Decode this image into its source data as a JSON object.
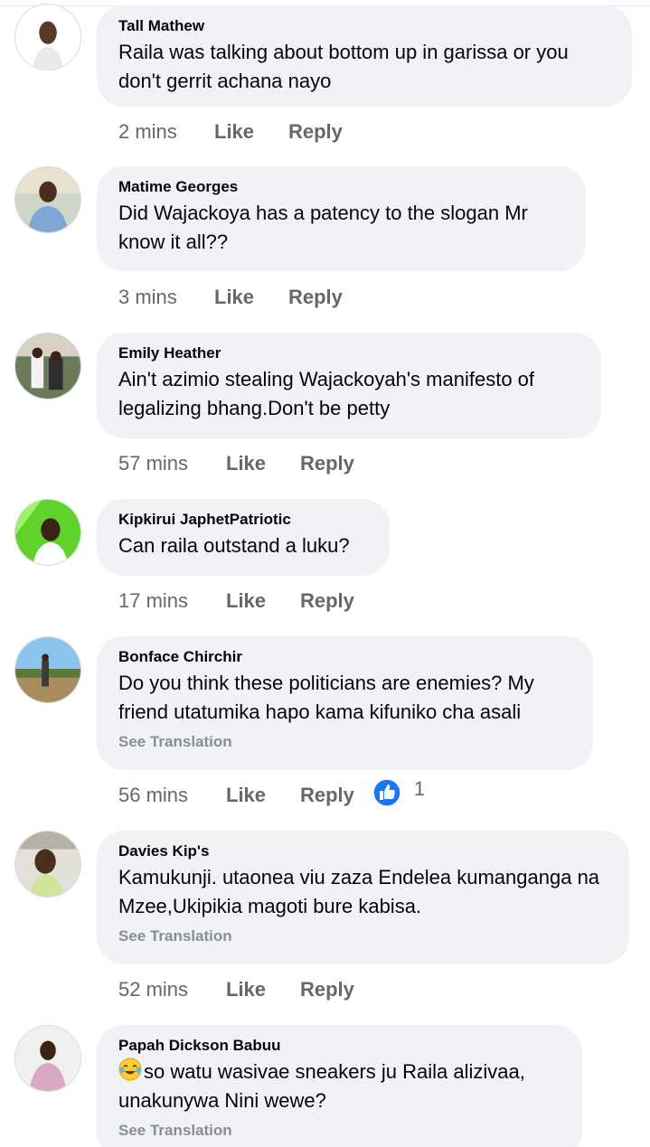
{
  "comments": [
    {
      "author": "Tall Mathew",
      "text": "Raila was talking about bottom up in garissa or you don't gerrit achana nayo",
      "time": "2 mins",
      "like_label": "Like",
      "reply_label": "Reply"
    },
    {
      "author": "Matime Georges",
      "text": "Did Wajackoya has a patency to the slogan Mr know it all??",
      "time": "3 mins",
      "like_label": "Like",
      "reply_label": "Reply"
    },
    {
      "author": "Emily Heather",
      "text": "Ain't azimio stealing Wajackoyah's manifesto of legalizing bhang.Don't be petty",
      "time": "57 mins",
      "like_label": "Like",
      "reply_label": "Reply"
    },
    {
      "author": "Kipkirui JaphetPatriotic",
      "text": "Can raila outstand a luku?",
      "time": "17 mins",
      "like_label": "Like",
      "reply_label": "Reply"
    },
    {
      "author": "Bonface Chirchir",
      "text": "Do you think these politicians are enemies? My friend utatumika hapo kama kifuniko cha asali",
      "see_translation": "See Translation",
      "time": "56 mins",
      "like_label": "Like",
      "reply_label": "Reply",
      "reaction_icon": "thumbs-up-icon",
      "reaction_count": "1"
    },
    {
      "author": "Davies Kip's",
      "text": "Kamukunji. utaonea viu zaza Endelea kumanganga na Mzee,Ukipikia magoti bure kabisa.",
      "see_translation": "See Translation",
      "time": "52 mins",
      "like_label": "Like",
      "reply_label": "Reply"
    },
    {
      "author": "Papah Dickson Babuu",
      "emoji": "face-with-tears-of-joy-icon",
      "text": "so watu wasivae sneakers ju Raila alizivaa, unakunywa Nini wewe?",
      "see_translation": "See Translation"
    }
  ],
  "colors": {
    "bubble": "#f0f2f5",
    "meta_text": "#65676b",
    "translation_text": "#8a8d91",
    "reaction_blue": "#1877f2"
  }
}
